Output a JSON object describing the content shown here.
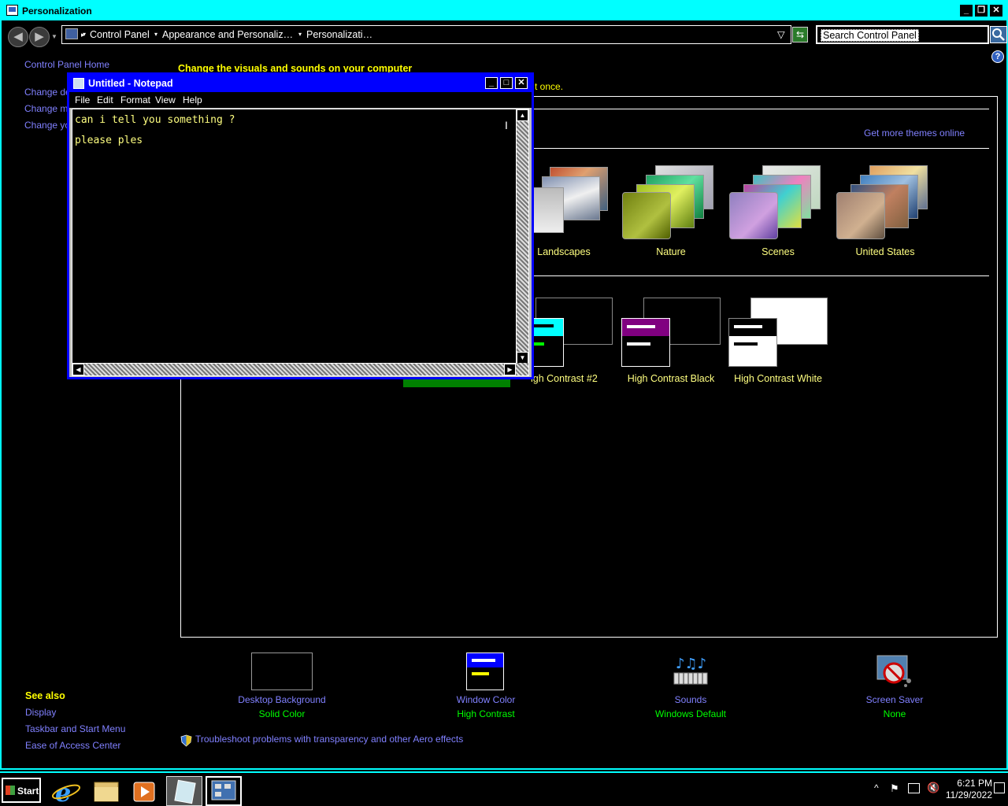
{
  "window": {
    "title": "Personalization",
    "min": "_",
    "max": "❐",
    "close": "✕"
  },
  "address": {
    "crumbs": [
      "Control Panel",
      "Appearance and Personaliz…",
      "Personalizati…"
    ],
    "search_placeholder": "Search Control Panel"
  },
  "sidebar": {
    "home": "Control Panel Home",
    "links": [
      "Change de",
      "Change mo",
      "Change yo"
    ],
    "see_also_title": "See also",
    "see_also": [
      "Display",
      "Taskbar and Start Menu",
      "Ease of Access Center"
    ]
  },
  "main": {
    "heading": "Change the visuals and sounds on your computer",
    "subtext_fragment": "t once.",
    "get_more_themes": "Get more themes online",
    "aero_themes": [
      "Landscapes",
      "Nature",
      "Scenes",
      "United States"
    ],
    "hc_themes": [
      "igh Contrast #2",
      "High Contrast Black",
      "High Contrast White"
    ],
    "troubleshoot": "Troubleshoot problems with transparency and other Aero effects"
  },
  "bottom": [
    {
      "label": "Desktop Background",
      "sub": "Solid Color",
      "icon": "desktop-background-icon"
    },
    {
      "label": "Window Color",
      "sub": "High Contrast",
      "icon": "window-color-icon"
    },
    {
      "label": "Sounds",
      "sub": "Windows Default",
      "icon": "sounds-icon"
    },
    {
      "label": "Screen Saver",
      "sub": "None",
      "icon": "screen-saver-icon"
    }
  ],
  "notepad": {
    "title": "Untitled - Notepad",
    "menu": [
      "File",
      "Edit",
      "Format",
      "View",
      "Help"
    ],
    "text": "can i tell you something ?\nplease ples"
  },
  "taskbar": {
    "start": "Start",
    "time": "6:21 PM",
    "date": "11/29/2022"
  },
  "colors": {
    "frame": "#00ffff",
    "notepad_frame": "#0000ff",
    "link": "#8080ff",
    "highlight_text": "#ffff00",
    "status_text": "#00ff00"
  }
}
